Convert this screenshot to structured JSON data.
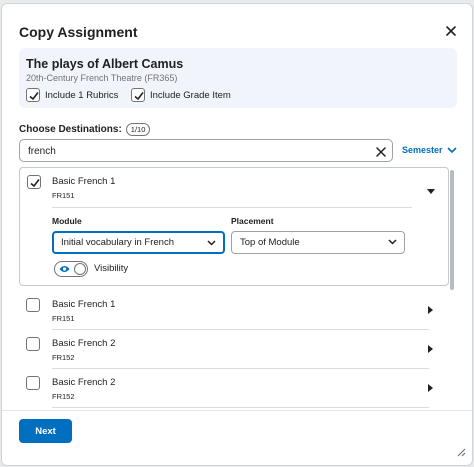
{
  "dialog": {
    "title": "Copy Assignment",
    "close_icon": "close-icon"
  },
  "summary": {
    "title": "The plays of Albert Camus",
    "subtitle": "20th-Century French Theatre (FR365)",
    "options": [
      {
        "label": "Include 1 Rubrics",
        "checked": true
      },
      {
        "label": "Include Grade Item",
        "checked": true
      }
    ]
  },
  "destinations": {
    "label": "Choose Destinations:",
    "count": "1/10",
    "search_value": "french",
    "filter_label": "Semester"
  },
  "expanded_item": {
    "name": "Basic French 1",
    "code": "FR151",
    "checked": true,
    "module_label": "Module",
    "module_value": "Initial vocabulary in French",
    "placement_label": "Placement",
    "placement_value": "Top of Module",
    "visibility_label": "Visibility",
    "visibility_on": true
  },
  "items": [
    {
      "name": "Basic French 1",
      "code": "FR151",
      "checked": false
    },
    {
      "name": "Basic French 2",
      "code": "FR152",
      "checked": false
    },
    {
      "name": "Basic French 2",
      "code": "FR152",
      "checked": false
    }
  ],
  "footer": {
    "next_label": "Next"
  },
  "colors": {
    "accent": "#006fbf",
    "summary_bg": "#f1f5fb"
  }
}
